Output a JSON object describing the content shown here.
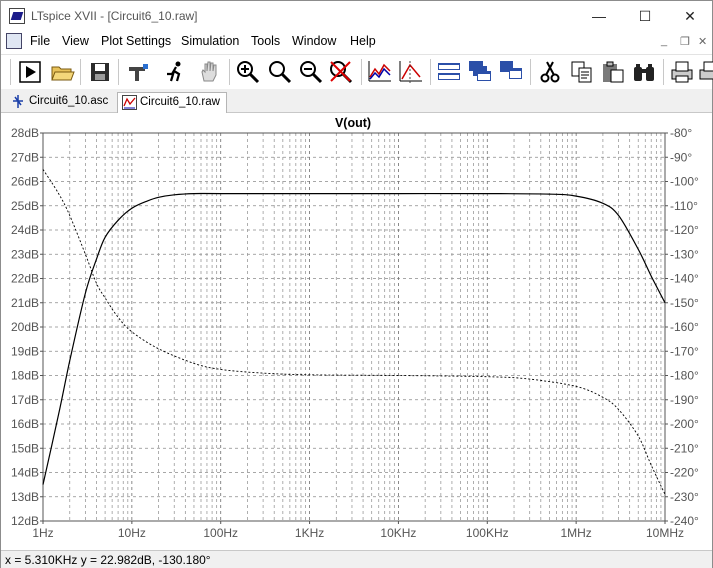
{
  "window": {
    "title": "LTspice XVII - [Circuit6_10.raw]",
    "minimize": "—",
    "maximize": "☐",
    "close": "✕"
  },
  "menu": {
    "file": "File",
    "view": "View",
    "plot_settings": "Plot Settings",
    "simulation": "Simulation",
    "tools": "Tools",
    "window": "Window",
    "help": "Help",
    "mdi_min": "_",
    "mdi_restore": "❐",
    "mdi_close": "✕"
  },
  "toolbar": {
    "buttons": [
      "run-icon",
      "open-icon",
      "save-icon",
      "control-panel-icon",
      "run-sim-icon",
      "pan-hand-icon",
      "zoom-in-icon",
      "zoom-area-icon",
      "zoom-out-icon",
      "zoom-fit-icon",
      "autorange-icon",
      "mark-icon",
      "tile-horiz-icon",
      "cascade-icon",
      "tile-vert-icon",
      "cut-icon",
      "copy-icon",
      "paste-icon",
      "find-icon",
      "print-icon",
      "print-setup-icon"
    ]
  },
  "tabs": [
    {
      "label": "Circuit6_10.asc",
      "icon": "schematic-icon",
      "active": false
    },
    {
      "label": "Circuit6_10.raw",
      "icon": "waveform-icon",
      "active": true
    }
  ],
  "statusbar": {
    "text": "x = 5.310KHz    y = 22.982dB, -130.180°"
  },
  "chart_data": {
    "type": "line",
    "title": "V(out)",
    "x_scale": "log",
    "xlim": [
      1,
      10000000
    ],
    "x_tick_labels": [
      "1Hz",
      "10Hz",
      "100Hz",
      "1KHz",
      "10KHz",
      "100KHz",
      "1MHz",
      "10MHz"
    ],
    "x_tick_values": [
      1,
      10,
      100,
      1000,
      10000,
      100000,
      1000000,
      10000000
    ],
    "ylim": [
      12,
      28
    ],
    "y_tick_labels": [
      "28dB",
      "27dB",
      "26dB",
      "25dB",
      "24dB",
      "23dB",
      "22dB",
      "21dB",
      "20dB",
      "19dB",
      "18dB",
      "17dB",
      "16dB",
      "15dB",
      "14dB",
      "13dB",
      "12dB"
    ],
    "y_tick_values": [
      28,
      27,
      26,
      25,
      24,
      23,
      22,
      21,
      20,
      19,
      18,
      17,
      16,
      15,
      14,
      13,
      12
    ],
    "y2lim": [
      -240,
      -80
    ],
    "y2_tick_labels": [
      "-80°",
      "-90°",
      "-100°",
      "-110°",
      "-120°",
      "-130°",
      "-140°",
      "-150°",
      "-160°",
      "-170°",
      "-180°",
      "-190°",
      "-200°",
      "-210°",
      "-220°",
      "-230°",
      "-240°"
    ],
    "y2_tick_values": [
      -80,
      -90,
      -100,
      -110,
      -120,
      -130,
      -140,
      -150,
      -160,
      -170,
      -180,
      -190,
      -200,
      -210,
      -220,
      -230,
      -240
    ],
    "grid": true,
    "series": [
      {
        "axis": "left",
        "style": "solid",
        "x": [
          1,
          1.5,
          2,
          3,
          4,
          5,
          7,
          10,
          15,
          20,
          30,
          50,
          100,
          1000,
          10000,
          100000,
          500000,
          1000000,
          2000000,
          3000000,
          5000000,
          7000000,
          10000000
        ],
        "y": [
          13.5,
          16.4,
          18.6,
          21.4,
          22.8,
          23.7,
          24.4,
          24.9,
          25.2,
          25.35,
          25.45,
          25.5,
          25.5,
          25.5,
          25.5,
          25.5,
          25.48,
          25.4,
          25.1,
          24.6,
          23.2,
          22.1,
          21.0
        ]
      },
      {
        "axis": "right",
        "style": "dashed",
        "x": [
          1,
          1.5,
          2,
          3,
          4,
          5,
          7,
          10,
          20,
          50,
          100,
          300,
          1000,
          10000,
          100000,
          300000,
          1000000,
          2000000,
          3000000,
          5000000,
          7000000,
          10000000
        ],
        "y": [
          -95,
          -105,
          -114,
          -130,
          -142,
          -148,
          -156,
          -162,
          -169,
          -175,
          -177.5,
          -179,
          -179.7,
          -180,
          -180.5,
          -181.5,
          -184.5,
          -189,
          -194,
          -205,
          -217,
          -229
        ]
      }
    ]
  }
}
